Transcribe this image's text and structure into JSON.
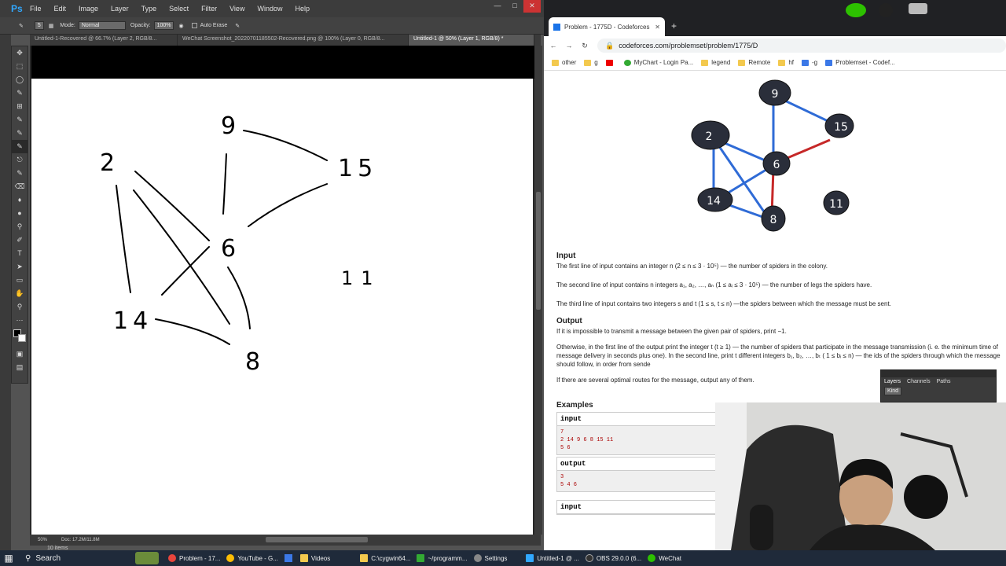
{
  "photoshop": {
    "logo": "Ps",
    "menu": [
      "File",
      "Edit",
      "Image",
      "Layer",
      "Type",
      "Select",
      "Filter",
      "View",
      "Window",
      "Help"
    ],
    "options": {
      "mode_label": "Mode:",
      "mode_value": "Normal",
      "opacity_label": "Opacity:",
      "opacity_value": "100%",
      "auto_erase": "Auto Erase",
      "brush_size": "5"
    },
    "tabs": [
      "Untitled-1-Recovered @ 66.7% (Layer 2, RGB/8...",
      "WeChat Screenshot_20220701185502-Recovered.png @ 100% (Layer 0, RGB/8...",
      "Untitled-1 @ 50% (Layer 1, RGB/8) *"
    ],
    "status": {
      "zoom": "50%",
      "doc": "Doc: 17.2M/11.8M"
    },
    "bottom_items": "10 items",
    "drawing_labels": [
      "9",
      "2",
      "15",
      "6",
      "14",
      "11",
      "8"
    ]
  },
  "browser": {
    "tab_title": "Problem - 1775D - Codeforces",
    "url": "codeforces.com/problemset/problem/1775/D",
    "bookmarks": [
      "other",
      "g",
      "MyChart - Login Pa...",
      "legend",
      "Remote",
      "hf",
      "-g",
      "Problemset - Codef..."
    ],
    "spider_labels": [
      "9",
      "2",
      "15",
      "6",
      "14",
      "11",
      "8"
    ]
  },
  "problem": {
    "input_heading": "Input",
    "input_line1": "The first line of input contains an integer n (2 ≤ n ≤ 3 · 10⁵) — the number of spiders in the colony.",
    "input_line2": "The second line of input contains n integers a₁, a₂, …, aₙ (1 ≤ aᵢ ≤ 3 · 10⁵) — the number of legs the spiders have.",
    "input_line3": "The third line of input contains two integers s and t (1 ≤ s, t ≤ n) —the spiders between which the message must be sent.",
    "output_heading": "Output",
    "output_line1": "If it is impossible to transmit a message between the given pair of spiders, print −1.",
    "output_line2": "Otherwise, in the first line of the output print the integer t (t ≥ 1) — the number of spiders that participate in the message transmission (i. e. the minimum time of message delivery in seconds plus one). In the second line, print t different integers b₁, b₂, …, bₜ ( 1 ≤ bᵢ ≤ n) — the ids of the spiders through which the message should follow, in order from sende",
    "output_line3": "If there are several optimal routes for the message, output any of them.",
    "examples_heading": "Examples",
    "ex_input_label": "input",
    "ex_input_body": "7\n2 14 9 6 8 15 11\n5 6",
    "ex_output_label": "output",
    "ex_output_body": "3\n5 4 6",
    "ex_input2_label": "input"
  },
  "layers_panel": {
    "tabs": [
      "Layers",
      "Channels",
      "Paths"
    ],
    "kind": "Kind"
  },
  "taskbar": {
    "search": "Search",
    "items": [
      "Problem - 17...",
      "YouTube - G...",
      "Videos",
      "C:\\cygwin64...",
      "~/programm...",
      "Settings",
      "Untitled-1 @ ...",
      "OBS 29.0.0 (6...",
      "WeChat"
    ]
  }
}
